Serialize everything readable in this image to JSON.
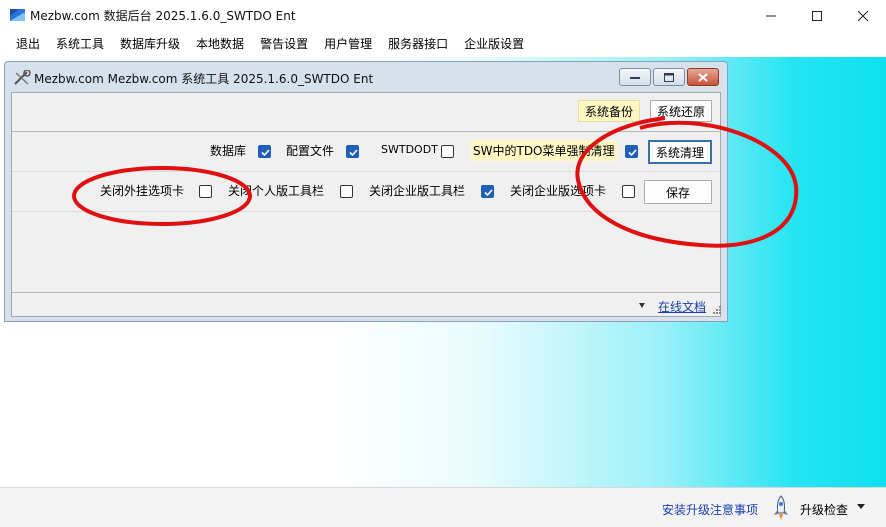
{
  "main_window": {
    "title": "Mezbw.com 数据后台 2025.1.6.0_SWTDO Ent",
    "menu": [
      "退出",
      "系统工具",
      "数据库升级",
      "本地数据",
      "警告设置",
      "用户管理",
      "服务器接口",
      "企业版设置"
    ]
  },
  "child_window": {
    "title": "Mezbw.com Mezbw.com 系统工具 2025.1.6.0_SWTDO Ent",
    "row1": {
      "backup_button": "系统备份",
      "restore_button": "系统还原"
    },
    "row2": {
      "database_label": "数据库",
      "database_checked": true,
      "config_label": "配置文件",
      "config_checked": true,
      "swtdodt_label": "SWTDODT",
      "swtdodt_checked": false,
      "sw_tdo_menu_label": "SW中的TDO菜单强制清理",
      "sw_tdo_menu_checked": true,
      "clean_button": "系统清理"
    },
    "row3": {
      "close_addin_tab_label": "关闭外挂选项卡",
      "close_addin_tab_checked": false,
      "close_personal_toolbar_label": "关闭个人版工具栏",
      "close_personal_toolbar_checked": false,
      "close_enterprise_toolbar_label": "关闭企业版工具栏",
      "close_enterprise_toolbar_checked": true,
      "close_enterprise_tab_label": "关闭企业版选项卡",
      "close_enterprise_tab_checked": false,
      "save_button": "保存"
    },
    "online_docs_link": "在线文档"
  },
  "statusbar": {
    "install_notes_link": "安装升级注意事项",
    "upgrade_check": "升级检查"
  },
  "colors": {
    "annotation_red": "#e01010",
    "checkbox_blue": "#1f5fb8",
    "link_blue": "#1a3fb0",
    "gradient_cyan": "#0fe0ef"
  }
}
